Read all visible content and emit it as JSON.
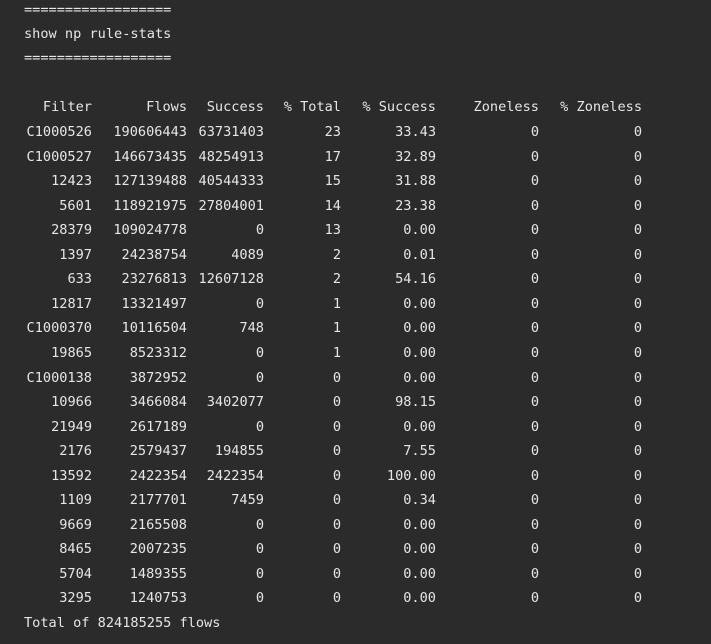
{
  "terminal": {
    "separator_top": "==================",
    "command": "show np rule-stats",
    "separator_bottom": "==================",
    "headers": {
      "filter": "Filter",
      "flows": "Flows",
      "success": "Success",
      "pct_total": "% Total",
      "pct_success": "% Success",
      "zoneless": "Zoneless",
      "pct_zoneless": "% Zoneless"
    },
    "rows": [
      {
        "filter": "C1000526",
        "flows": "190606443",
        "success": "63731403",
        "pct_total": "23",
        "pct_success": "33.43",
        "zoneless": "0",
        "pct_zoneless": "0"
      },
      {
        "filter": "C1000527",
        "flows": "146673435",
        "success": "48254913",
        "pct_total": "17",
        "pct_success": "32.89",
        "zoneless": "0",
        "pct_zoneless": "0"
      },
      {
        "filter": "12423",
        "flows": "127139488",
        "success": "40544333",
        "pct_total": "15",
        "pct_success": "31.88",
        "zoneless": "0",
        "pct_zoneless": "0"
      },
      {
        "filter": "5601",
        "flows": "118921975",
        "success": "27804001",
        "pct_total": "14",
        "pct_success": "23.38",
        "zoneless": "0",
        "pct_zoneless": "0"
      },
      {
        "filter": "28379",
        "flows": "109024778",
        "success": "0",
        "pct_total": "13",
        "pct_success": "0.00",
        "zoneless": "0",
        "pct_zoneless": "0"
      },
      {
        "filter": "1397",
        "flows": "24238754",
        "success": "4089",
        "pct_total": "2",
        "pct_success": "0.01",
        "zoneless": "0",
        "pct_zoneless": "0"
      },
      {
        "filter": "633",
        "flows": "23276813",
        "success": "12607128",
        "pct_total": "2",
        "pct_success": "54.16",
        "zoneless": "0",
        "pct_zoneless": "0"
      },
      {
        "filter": "12817",
        "flows": "13321497",
        "success": "0",
        "pct_total": "1",
        "pct_success": "0.00",
        "zoneless": "0",
        "pct_zoneless": "0"
      },
      {
        "filter": "C1000370",
        "flows": "10116504",
        "success": "748",
        "pct_total": "1",
        "pct_success": "0.00",
        "zoneless": "0",
        "pct_zoneless": "0"
      },
      {
        "filter": "19865",
        "flows": "8523312",
        "success": "0",
        "pct_total": "1",
        "pct_success": "0.00",
        "zoneless": "0",
        "pct_zoneless": "0"
      },
      {
        "filter": "C1000138",
        "flows": "3872952",
        "success": "0",
        "pct_total": "0",
        "pct_success": "0.00",
        "zoneless": "0",
        "pct_zoneless": "0"
      },
      {
        "filter": "10966",
        "flows": "3466084",
        "success": "3402077",
        "pct_total": "0",
        "pct_success": "98.15",
        "zoneless": "0",
        "pct_zoneless": "0"
      },
      {
        "filter": "21949",
        "flows": "2617189",
        "success": "0",
        "pct_total": "0",
        "pct_success": "0.00",
        "zoneless": "0",
        "pct_zoneless": "0"
      },
      {
        "filter": "2176",
        "flows": "2579437",
        "success": "194855",
        "pct_total": "0",
        "pct_success": "7.55",
        "zoneless": "0",
        "pct_zoneless": "0"
      },
      {
        "filter": "13592",
        "flows": "2422354",
        "success": "2422354",
        "pct_total": "0",
        "pct_success": "100.00",
        "zoneless": "0",
        "pct_zoneless": "0"
      },
      {
        "filter": "1109",
        "flows": "2177701",
        "success": "7459",
        "pct_total": "0",
        "pct_success": "0.34",
        "zoneless": "0",
        "pct_zoneless": "0"
      },
      {
        "filter": "9669",
        "flows": "2165508",
        "success": "0",
        "pct_total": "0",
        "pct_success": "0.00",
        "zoneless": "0",
        "pct_zoneless": "0"
      },
      {
        "filter": "8465",
        "flows": "2007235",
        "success": "0",
        "pct_total": "0",
        "pct_success": "0.00",
        "zoneless": "0",
        "pct_zoneless": "0"
      },
      {
        "filter": "5704",
        "flows": "1489355",
        "success": "0",
        "pct_total": "0",
        "pct_success": "0.00",
        "zoneless": "0",
        "pct_zoneless": "0"
      },
      {
        "filter": "3295",
        "flows": "1240753",
        "success": "0",
        "pct_total": "0",
        "pct_success": "0.00",
        "zoneless": "0",
        "pct_zoneless": "0"
      }
    ],
    "footer": "Total of 824185255 flows"
  }
}
